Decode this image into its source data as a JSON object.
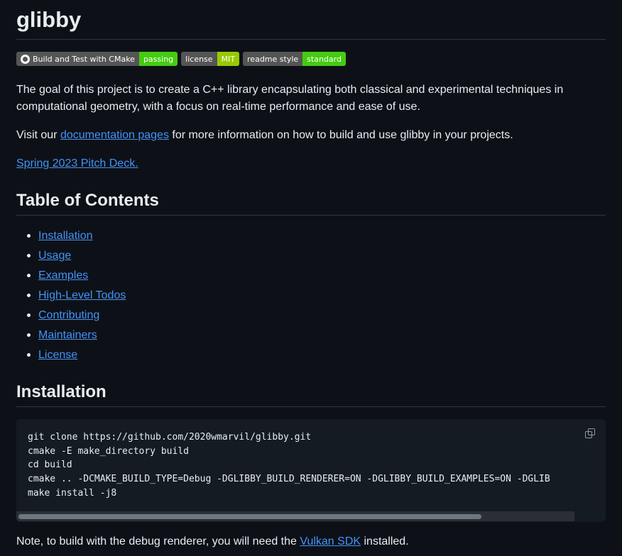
{
  "title": "glibby",
  "badges": [
    {
      "label": "Build and Test with CMake",
      "value": "passing",
      "color": "#4c1"
    },
    {
      "label": "license",
      "value": "MIT",
      "color": "#97ca00"
    },
    {
      "label": "readme style",
      "value": "standard",
      "color": "#4c1"
    }
  ],
  "intro": "The goal of this project is to create a C++ library encapsulating both classical and experimental techniques in computational geometry, with a focus on real-time performance and ease of use.",
  "visit": {
    "before": "Visit our ",
    "link": "documentation pages",
    "after": " for more information on how to build and use glibby in your projects."
  },
  "pitch_link": "Spring 2023 Pitch Deck.",
  "toc": {
    "heading": "Table of Contents",
    "items": [
      "Installation",
      "Usage",
      "Examples",
      "High-Level Todos",
      "Contributing",
      "Maintainers",
      "License"
    ]
  },
  "installation": {
    "heading": "Installation",
    "code": "git clone https://github.com/2020wmarvil/glibby.git\ncmake -E make_directory build\ncd build\ncmake .. -DCMAKE_BUILD_TYPE=Debug -DGLIBBY_BUILD_RENDERER=ON -DGLIBBY_BUILD_EXAMPLES=ON -DGLIB\nmake install -j8",
    "copy_icon": "copy-icon"
  },
  "note": {
    "before": "Note, to build with the debug renderer, you will need the ",
    "link": "Vulkan SDK",
    "after": " installed."
  }
}
